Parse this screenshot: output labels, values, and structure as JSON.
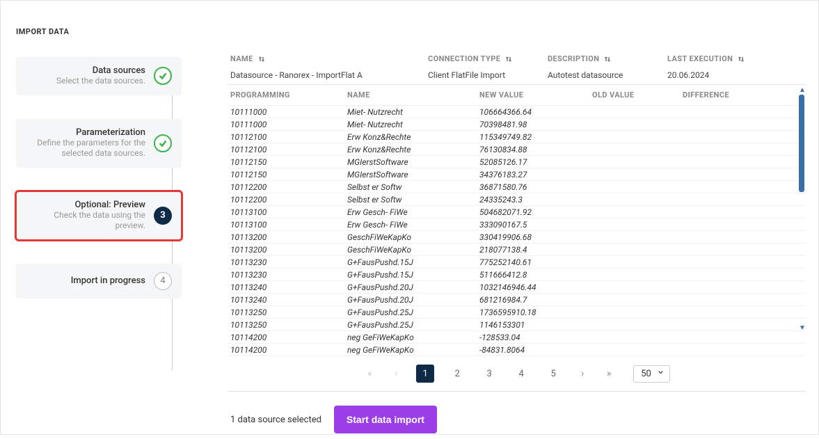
{
  "page_title": "IMPORT DATA",
  "steps": [
    {
      "title": "Data sources",
      "desc": "Select the data sources.",
      "state": "done"
    },
    {
      "title": "Parameterization",
      "desc": "Define the parameters for the selected data sources.",
      "state": "done"
    },
    {
      "title": "Optional: Preview",
      "desc": "Check the data using the preview.",
      "state": "current",
      "num": "3"
    },
    {
      "title": "Import in progress",
      "desc": "",
      "state": "pending",
      "num": "4"
    }
  ],
  "ds_headers": {
    "name": "NAME",
    "conn": "CONNECTION TYPE",
    "desc": "DESCRIPTION",
    "last": "LAST EXECUTION"
  },
  "ds_row": {
    "name": "Datasource - Ranorex - ImportFlat A",
    "conn": "Client FlatFile Import",
    "desc": "Autotest datasource",
    "last": "20.06.2024"
  },
  "data_headers": {
    "c1": "PROGRAMMING",
    "c2": "NAME",
    "c3": "NEW VALUE",
    "c4": "OLD VALUE",
    "c5": "DIFFERENCE"
  },
  "rows": [
    {
      "c1": "10111000",
      "c2": "Miet- Nutzrecht",
      "c3": "106664366.64"
    },
    {
      "c1": "10111000",
      "c2": "Miet- Nutzrecht",
      "c3": "70398481.98"
    },
    {
      "c1": "10112100",
      "c2": "Erw Konz&Rechte",
      "c3": "115349749.82"
    },
    {
      "c1": "10112100",
      "c2": "Erw Konz&Rechte",
      "c3": "76130834.88"
    },
    {
      "c1": "10112150",
      "c2": "MGIerstSoftware",
      "c3": "52085126.17"
    },
    {
      "c1": "10112150",
      "c2": "MGIerstSoftware",
      "c3": "34376183.27"
    },
    {
      "c1": "10112200",
      "c2": "Selbst er Softw",
      "c3": "36871580.76"
    },
    {
      "c1": "10112200",
      "c2": "Selbst er Softw",
      "c3": "24335243.3"
    },
    {
      "c1": "10113100",
      "c2": "Erw Gesch- FiWe",
      "c3": "504682071.92"
    },
    {
      "c1": "10113100",
      "c2": "Erw Gesch- FiWe",
      "c3": "333090167.5"
    },
    {
      "c1": "10113200",
      "c2": "GeschFiWeKapKo",
      "c3": "330419906.68"
    },
    {
      "c1": "10113200",
      "c2": "GeschFiWeKapKo",
      "c3": "218077138.4"
    },
    {
      "c1": "10113230",
      "c2": "G+FausPushd.15J",
      "c3": "775252140.61"
    },
    {
      "c1": "10113230",
      "c2": "G+FausPushd.15J",
      "c3": "511666412.8"
    },
    {
      "c1": "10113240",
      "c2": "G+FausPushd.20J",
      "c3": "1032146946.44"
    },
    {
      "c1": "10113240",
      "c2": "G+FausPushd.20J",
      "c3": "681216984.7"
    },
    {
      "c1": "10113250",
      "c2": "G+FausPushd.25J",
      "c3": "1736595910.18"
    },
    {
      "c1": "10113250",
      "c2": "G+FausPushd.25J",
      "c3": "1146153301"
    },
    {
      "c1": "10114200",
      "c2": "neg GeFiWeKapKo",
      "c3": "-128533.04"
    },
    {
      "c1": "10114200",
      "c2": "neg GeFiWeKapKo",
      "c3": "-84831.8064"
    }
  ],
  "pagination": {
    "pages": [
      "1",
      "2",
      "3",
      "4",
      "5"
    ],
    "active": "1",
    "page_size": "50"
  },
  "selected_text": "1 data source selected",
  "start_label": "Start data import"
}
